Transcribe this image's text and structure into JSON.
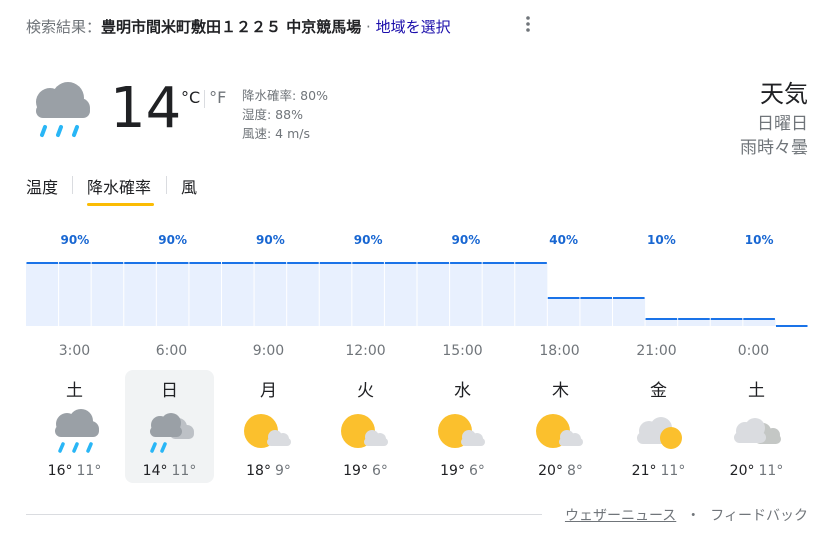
{
  "header": {
    "prefix": "検索結果：",
    "location": "豊明市間米町敷田１２２５ 中京競馬場",
    "separator": " · ",
    "change_region": "地域を選択",
    "more_icon": "more-vert-icon"
  },
  "current": {
    "icon": "rain-cloud-icon",
    "temperature": "14",
    "unit_c": "°C",
    "unit_f": "°F",
    "precipitation": "降水確率: 80%",
    "humidity": "湿度: 88%",
    "wind": "風速: 4 m/s"
  },
  "summary": {
    "title": "天気",
    "day": "日曜日",
    "condition": "雨時々曇"
  },
  "tabs": [
    {
      "label": "温度",
      "selected": false
    },
    {
      "label": "降水確率",
      "selected": true
    },
    {
      "label": "風",
      "selected": false
    }
  ],
  "chart_data": {
    "type": "area",
    "categories": [
      "3:00",
      "6:00",
      "9:00",
      "12:00",
      "15:00",
      "18:00",
      "21:00",
      "0:00"
    ],
    "values": [
      90,
      90,
      90,
      90,
      90,
      40,
      10,
      10
    ],
    "value_labels": [
      "90%",
      "90%",
      "90%",
      "90%",
      "90%",
      "40%",
      "10%",
      "10%"
    ],
    "hourly_values": [
      90,
      90,
      90,
      90,
      90,
      90,
      90,
      90,
      90,
      90,
      90,
      90,
      90,
      90,
      90,
      90,
      40,
      40,
      40,
      10,
      10,
      10,
      10,
      0
    ],
    "ylim": [
      0,
      100
    ],
    "line_color": "#1a73e8",
    "fill_color": "#e8f0fe",
    "label_color": "#1967d2"
  },
  "days": [
    {
      "name": "土",
      "icon": "rain-cloud-icon",
      "high": "16°",
      "low": "11°",
      "selected": false
    },
    {
      "name": "日",
      "icon": "rain-cloud-partly-icon",
      "high": "14°",
      "low": "11°",
      "selected": true
    },
    {
      "name": "月",
      "icon": "sun-cloud-icon",
      "high": "18°",
      "low": "9°",
      "selected": false
    },
    {
      "name": "火",
      "icon": "sun-cloud-icon",
      "high": "19°",
      "low": "6°",
      "selected": false
    },
    {
      "name": "水",
      "icon": "sun-cloud-icon",
      "high": "19°",
      "low": "6°",
      "selected": false
    },
    {
      "name": "木",
      "icon": "sun-cloud-icon",
      "high": "20°",
      "low": "8°",
      "selected": false
    },
    {
      "name": "金",
      "icon": "cloud-sun-icon",
      "high": "21°",
      "low": "11°",
      "selected": false
    },
    {
      "name": "土",
      "icon": "cloudy-icon",
      "high": "20°",
      "low": "11°",
      "selected": false
    }
  ],
  "footer": {
    "weather_news": "ウェザーニュース",
    "bullet": "・",
    "feedback": "フィードバック"
  }
}
